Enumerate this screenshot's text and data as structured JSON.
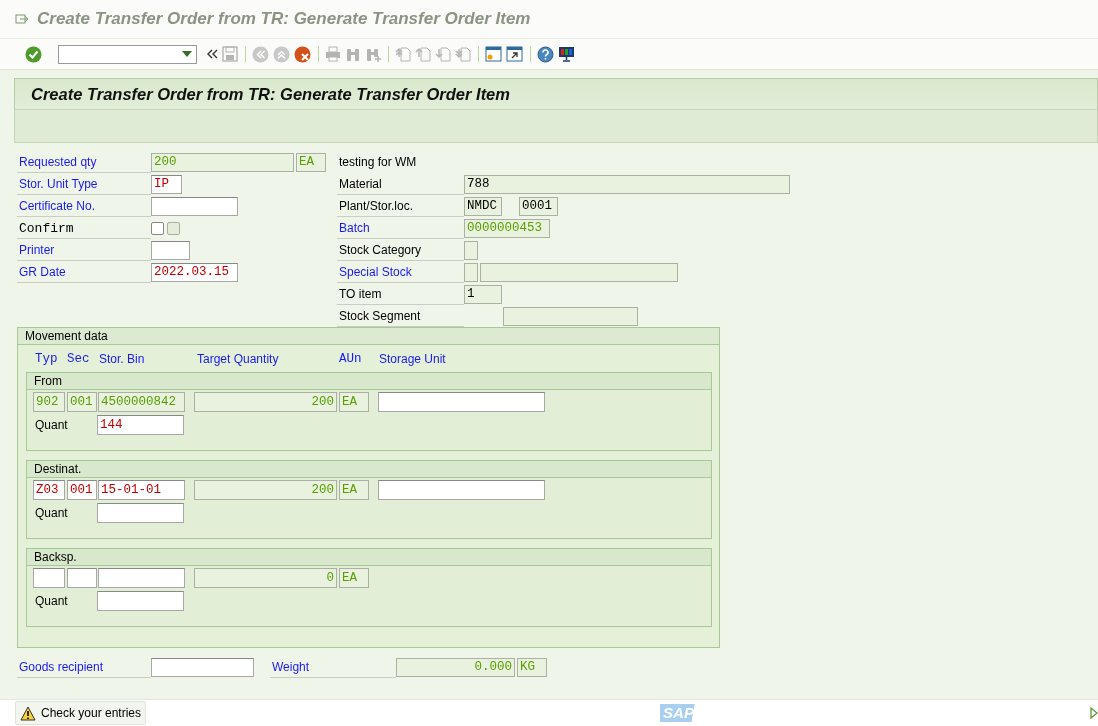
{
  "window": {
    "title": "Create Transfer Order from TR: Generate Transfer Order Item"
  },
  "screen_title": "Create Transfer Order from TR: Generate Transfer Order Item",
  "header_left": [
    {
      "label": {
        "text": "Requested qty",
        "link": true,
        "mono": false
      },
      "fields": [
        {
          "kind": "field",
          "value": "200",
          "editable": false,
          "color": "#5a9e00"
        },
        {
          "kind": "field",
          "value": "EA",
          "editable": false,
          "color": "#5a9e00"
        }
      ]
    },
    {
      "label": {
        "text": "Stor. Unit Type",
        "link": true,
        "mono": false
      },
      "fields": [
        {
          "kind": "field",
          "value": "IP",
          "editable": true,
          "color": "#c00000"
        }
      ]
    },
    {
      "label": {
        "text": "Certificate No.",
        "link": true,
        "mono": false
      },
      "fields": [
        {
          "kind": "field",
          "editable": true
        }
      ]
    },
    {
      "label": {
        "text": "Confirm",
        "link": false,
        "mono": true
      },
      "fields": [
        {
          "kind": "checkbox",
          "checked": false,
          "disabled": false
        },
        {
          "kind": "checkbox",
          "checked": false,
          "disabled": true
        }
      ]
    },
    {
      "label": {
        "text": "Printer",
        "link": true,
        "mono": false
      },
      "fields": [
        {
          "kind": "field",
          "editable": true
        }
      ]
    },
    {
      "label": {
        "text": "GR Date",
        "link": true,
        "mono": false
      },
      "fields": [
        {
          "kind": "field",
          "value": "2022.03.15",
          "editable": true,
          "color": "#c00000"
        }
      ]
    }
  ],
  "header_right": [
    {
      "label": {
        "text": "testing for WM",
        "link": false,
        "mono": false,
        "plain": true
      }
    },
    {
      "label": {
        "text": "Material",
        "link": false,
        "mono": false
      },
      "fields": [
        {
          "kind": "field",
          "value": "788",
          "editable": false,
          "color": "#000000"
        }
      ]
    },
    {
      "label": {
        "text": "Plant/Stor.loc.",
        "link": false,
        "mono": false
      },
      "fields": [
        {
          "kind": "field",
          "value": "NMDC",
          "editable": false,
          "color": "#000000"
        },
        {
          "kind": "field",
          "value": "0001",
          "editable": false,
          "color": "#000000"
        }
      ]
    },
    {
      "label": {
        "text": "Batch",
        "link": true,
        "mono": false
      },
      "fields": [
        {
          "kind": "field",
          "value": "0000000453",
          "editable": false,
          "color": "#5a9e00"
        }
      ]
    },
    {
      "label": {
        "text": "Stock Category",
        "link": false,
        "mono": false
      },
      "fields": [
        {
          "kind": "field",
          "editable": false
        }
      ]
    },
    {
      "label": {
        "text": "Special Stock",
        "link": true,
        "mono": false
      },
      "fields": [
        {
          "kind": "field",
          "editable": false
        },
        {
          "kind": "field",
          "editable": false
        }
      ]
    },
    {
      "label": {
        "text": "TO item",
        "link": false,
        "mono": false
      },
      "fields": [
        {
          "kind": "field",
          "value": "1",
          "editable": false,
          "color": "#000000"
        }
      ]
    },
    {
      "label": {
        "text": "Stock Segment",
        "link": false,
        "mono": false
      },
      "fields": [
        {
          "kind": "field",
          "editable": false
        }
      ]
    }
  ],
  "movement_data": {
    "title": "Movement data",
    "columns": [
      "Typ",
      "Sec",
      "Stor. Bin",
      "Target Quantity",
      "AUn",
      "Storage Unit"
    ],
    "groups": [
      {
        "title": "From",
        "fields": [
          {
            "value": "902",
            "editable": false,
            "color": "#5a9e00"
          },
          {
            "value": "001",
            "editable": false,
            "color": "#5a9e00"
          },
          {
            "value": "4500000842",
            "editable": false,
            "color": "#5a9e00"
          },
          {
            "value": "200",
            "editable": false,
            "color": "#5a9e00"
          },
          {
            "value": "EA",
            "editable": false,
            "color": "#5a9e00"
          },
          {
            "editable": true
          }
        ],
        "quant_label": "Quant",
        "quant": {
          "value": "144",
          "editable": true,
          "color": "#c00000"
        }
      },
      {
        "title": "Destinat.",
        "fields": [
          {
            "value": "Z03",
            "editable": true,
            "color": "#c00000"
          },
          {
            "value": "001",
            "editable": true,
            "color": "#c00000"
          },
          {
            "value": "15-01-01",
            "editable": true,
            "color": "#c00000"
          },
          {
            "value": "200",
            "editable": false,
            "color": "#5a9e00"
          },
          {
            "value": "EA",
            "editable": false,
            "color": "#5a9e00"
          },
          {
            "editable": true
          }
        ],
        "quant_label": "Quant",
        "quant": {
          "editable": true
        }
      },
      {
        "title": "Backsp.",
        "fields": [
          {
            "editable": true
          },
          {
            "editable": true
          },
          {
            "editable": true
          },
          {
            "value": "0",
            "editable": false,
            "color": "#5a9e00"
          },
          {
            "value": "EA",
            "editable": false,
            "color": "#5a9e00"
          }
        ],
        "quant_label": "Quant",
        "quant": {
          "editable": true
        }
      }
    ]
  },
  "footer": [
    {
      "label": {
        "text": "Goods recipient",
        "link": true,
        "mono": false
      },
      "fields": [
        {
          "kind": "field",
          "editable": true
        }
      ]
    },
    {
      "label": {
        "text": "Weight",
        "link": true,
        "mono": false
      },
      "fields": [
        {
          "kind": "field",
          "value": "0.000",
          "editable": false,
          "color": "#5a9e00"
        },
        {
          "kind": "field",
          "value": "KG",
          "editable": false,
          "color": "#5a9e00"
        }
      ]
    }
  ],
  "status_bar": {
    "kind": "warning",
    "message": "Check your entries"
  },
  "logo": "SAP"
}
